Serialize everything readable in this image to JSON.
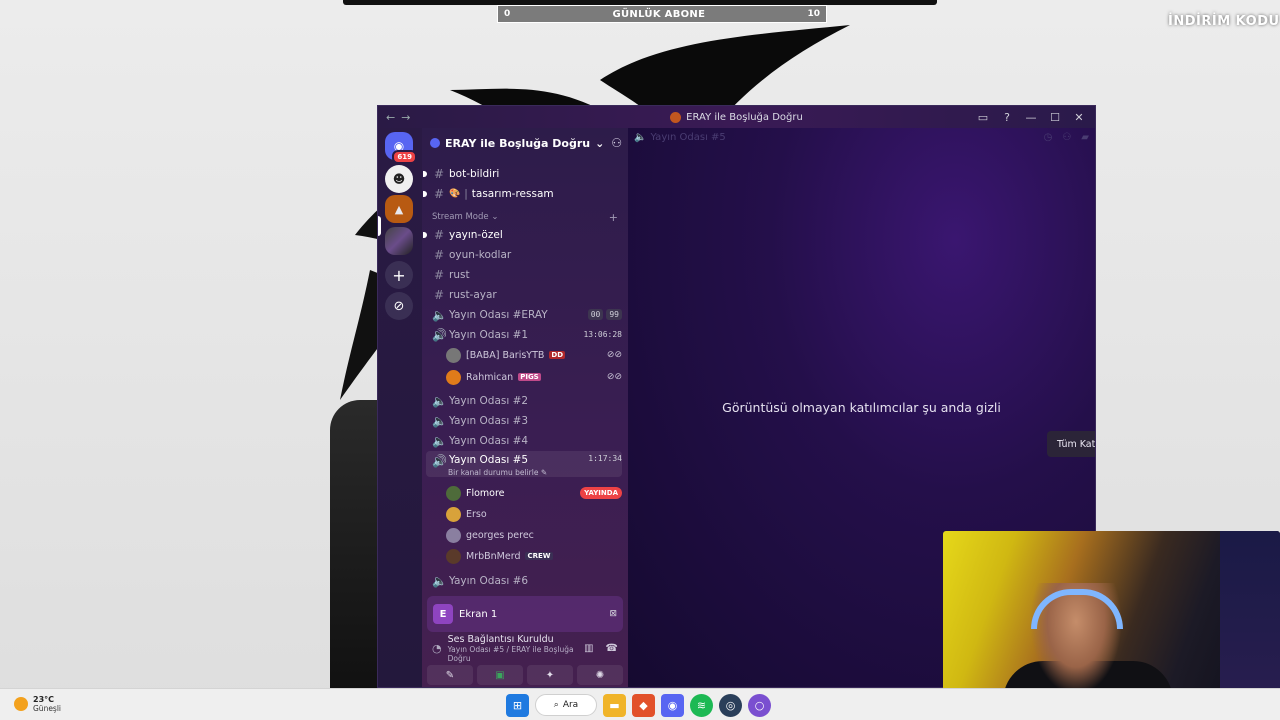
{
  "stream": {
    "sub_counter": {
      "label": "GÜNLÜK ABONE",
      "min": "0",
      "max": "10"
    },
    "promo": {
      "title": "İNDİRİM KODU",
      "code": ""
    }
  },
  "window": {
    "title": "ERAY ile Boşluğa Doğru",
    "nav_back": "←",
    "nav_forward": "→",
    "controls": {
      "inbox": "▭",
      "help": "?",
      "minimize": "—",
      "maximize": "☐",
      "close": "✕"
    }
  },
  "servers": {
    "home_badge": "619",
    "add_glyph": "+",
    "explore_glyph": "⊘"
  },
  "server": {
    "name": "ERAY ile Boşluğa Doğru",
    "dropdown_glyph": "⌄",
    "invite_glyph": "⚇"
  },
  "channels": {
    "top": [
      {
        "name": "bot-bildiri",
        "icon": "#"
      },
      {
        "name": "tasarım-ressam",
        "icon": "#",
        "emoji": "🎨"
      }
    ],
    "category": {
      "name": "Stream Mode ⌄",
      "add": "+"
    },
    "text": [
      {
        "name": "yayın-özel"
      },
      {
        "name": "oyun-kodlar"
      },
      {
        "name": "rust"
      },
      {
        "name": "rust-ayar"
      }
    ],
    "voice_eray": {
      "name": "Yayın Odası #ERAY",
      "count_a": "00",
      "count_b": "99"
    },
    "voice_1": {
      "name": "Yayın Odası #1",
      "timer": "13:06:28",
      "users": [
        {
          "name": "[BABA] BarisYTB",
          "tag": "DD",
          "right": "⊘⊘"
        },
        {
          "name": "Rahmican",
          "tag": "PIGS",
          "right": "⊘⊘"
        }
      ]
    },
    "voice_2": {
      "name": "Yayın Odası #2"
    },
    "voice_3": {
      "name": "Yayın Odası #3"
    },
    "voice_4": {
      "name": "Yayın Odası #4"
    },
    "voice_5": {
      "name": "Yayın Odası #5",
      "timer": "1:17:34",
      "status": "Bir kanal durumu belirle ✎",
      "users": [
        {
          "name": "Flomore",
          "live": "YAYINDA"
        },
        {
          "name": "Erso"
        },
        {
          "name": "georges perec"
        },
        {
          "name": "MrbBnMerd",
          "tag": "CREW"
        }
      ]
    },
    "voice_6": {
      "name": "Yayın Odası #6"
    }
  },
  "share": {
    "avatar_letter": "E",
    "label": "Ekran 1",
    "stop_glyph": "⊠"
  },
  "voice": {
    "status": "Ses Bağlantısı Kuruldu",
    "location": "Yayın Odası #5 / ERAY ile Boşluğa Doğru",
    "actions": [
      "✎",
      "▣",
      "✦",
      "✺"
    ]
  },
  "main": {
    "header": "Yayın Odası #5",
    "empty_message": "Görüntüsü olmayan katılımcılar şu anda gizli",
    "show_all_button": "Tüm Katılımcıları Göster"
  },
  "taskbar": {
    "weather_temp": "23°C",
    "weather_desc": "Güneşli",
    "search_label": "Ara"
  },
  "colors": {
    "discord_blurple": "#5865f2",
    "live_red": "#ed4245",
    "channel_bg": "#3a1e52"
  }
}
